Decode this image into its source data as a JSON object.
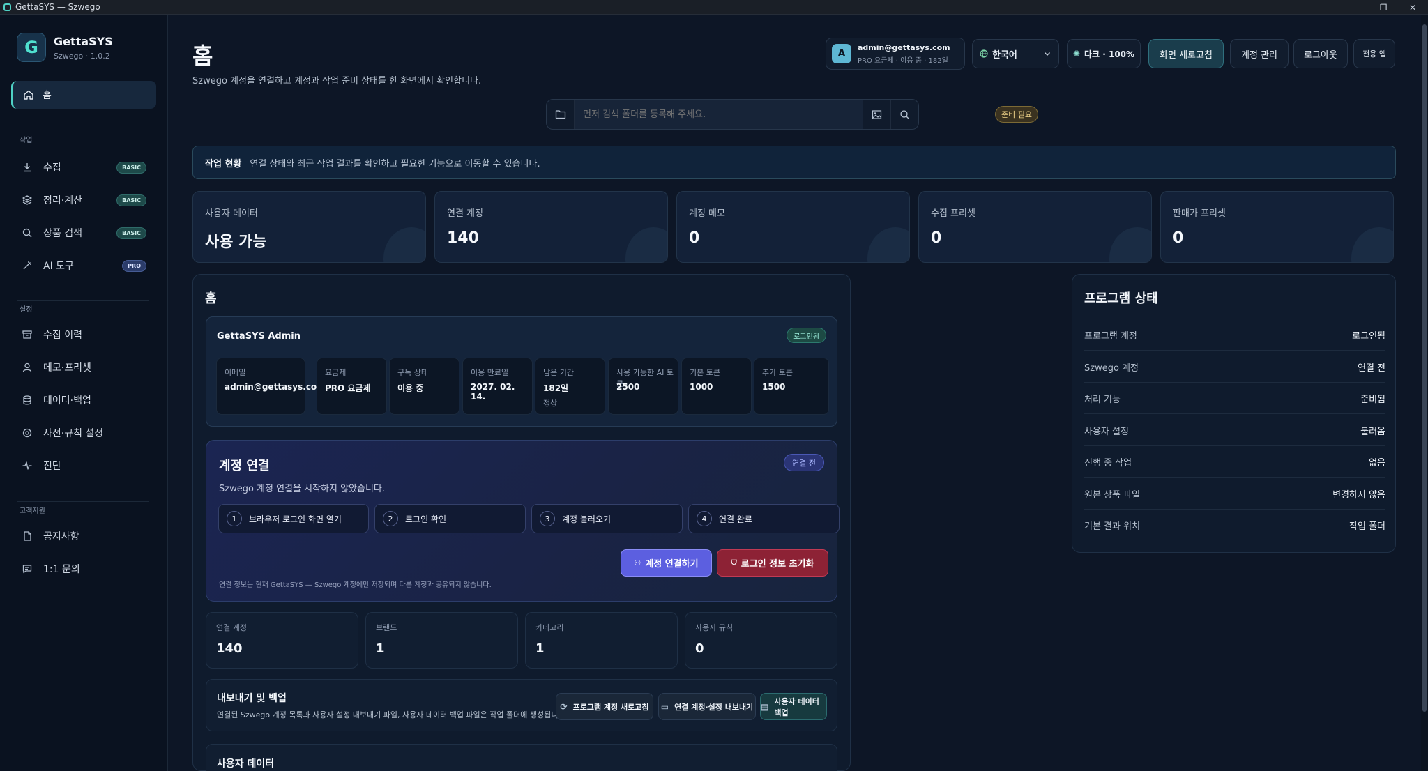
{
  "window": {
    "title": "GettaSYS — Szwego"
  },
  "brand": {
    "logo_letter": "G",
    "name": "GettaSYS",
    "version": "Szwego · 1.0.2"
  },
  "sidebar": {
    "home": "홈",
    "sections": {
      "work": "작업",
      "settings": "설정",
      "support": "고객지원"
    },
    "work_items": [
      {
        "label": "수집",
        "badge": "BASIC",
        "icon": "download-icon"
      },
      {
        "label": "정리·계산",
        "badge": "BASIC",
        "icon": "layers-icon"
      },
      {
        "label": "상품 검색",
        "badge": "BASIC",
        "icon": "search-icon"
      },
      {
        "label": "AI 도구",
        "badge": "PRO",
        "icon": "sparkle-icon"
      }
    ],
    "settings_items": [
      {
        "label": "수집 이력",
        "icon": "archive-icon"
      },
      {
        "label": "메모·프리셋",
        "icon": "user-icon"
      },
      {
        "label": "데이터·백업",
        "icon": "database-icon"
      },
      {
        "label": "사전·규칙 설정",
        "icon": "target-icon"
      },
      {
        "label": "진단",
        "icon": "pulse-icon"
      }
    ],
    "support_items": [
      {
        "label": "공지사항",
        "icon": "document-icon"
      },
      {
        "label": "1:1 문의",
        "icon": "chat-icon"
      }
    ]
  },
  "header": {
    "title": "홈",
    "subtitle": "Szwego 계정을 연결하고 계정과 작업 준비 상태를 한 화면에서 확인합니다.",
    "account": {
      "avatar": "A",
      "email": "admin@gettasys.com",
      "plan_info": "PRO 요금제 · 이용 중 · 182일"
    },
    "language": "한국어",
    "theme": "다크 · 100%",
    "refresh": "화면 새로고침",
    "account_manage": "계정 관리",
    "logout": "로그아웃",
    "dedicated_app": "전용 앱"
  },
  "search": {
    "placeholder": "먼저 검색 폴더를 등록해 주세요.",
    "status": "준비 필요"
  },
  "status_banner": {
    "title": "작업 현황",
    "text": "연결 상태와 최근 작업 결과를 확인하고 필요한 기능으로 이동할 수 있습니다."
  },
  "stats": [
    {
      "label": "사용자 데이터",
      "value": "사용 가능"
    },
    {
      "label": "연결 계정",
      "value": "140"
    },
    {
      "label": "계정 메모",
      "value": "0"
    },
    {
      "label": "수집 프리셋",
      "value": "0"
    },
    {
      "label": "판매가 프리셋",
      "value": "0"
    }
  ],
  "home_panel": {
    "title": "홈",
    "user": {
      "name": "GettaSYS Admin",
      "status": "로그인됨",
      "fields": [
        {
          "label": "이메일",
          "value": "admin@gettasys.com",
          "sub": ""
        },
        {
          "label": "요금제",
          "value": "PRO 요금제",
          "sub": ""
        },
        {
          "label": "구독 상태",
          "value": "이용 중",
          "sub": ""
        },
        {
          "label": "이용 만료일",
          "value": "2027. 02. 14.",
          "sub": ""
        },
        {
          "label": "남은 기간",
          "value": "182일",
          "sub": "정상"
        },
        {
          "label": "사용 가능한 AI 토큰",
          "value": "2500",
          "sub": ""
        },
        {
          "label": "기본 토큰",
          "value": "1000",
          "sub": ""
        },
        {
          "label": "추가 토큰",
          "value": "1500",
          "sub": ""
        }
      ]
    },
    "connection": {
      "title": "계정 연결",
      "badge": "연결 전",
      "subtitle": "Szwego 계정 연결을 시작하지 않았습니다.",
      "steps": [
        {
          "num": "1",
          "label": "브라우저 로그인 화면 열기"
        },
        {
          "num": "2",
          "label": "로그인 확인"
        },
        {
          "num": "3",
          "label": "계정 불러오기"
        },
        {
          "num": "4",
          "label": "연결 완료"
        }
      ],
      "connect_button": "계정 연결하기",
      "reset_button": "로그인 정보 초기화",
      "note": "연결 정보는 현재 GettaSYS — Szwego 계정에만 저장되며 다른 계정과 공유되지 않습니다."
    },
    "mini_stats": [
      {
        "label": "연결 계정",
        "value": "140"
      },
      {
        "label": "브랜드",
        "value": "1"
      },
      {
        "label": "카테고리",
        "value": "1"
      },
      {
        "label": "사용자 규칙",
        "value": "0"
      }
    ],
    "export": {
      "title": "내보내기 및 백업",
      "subtitle": "연결된 Szwego 계정 목록과 사용자 설정 내보내기 파일, 사용자 데이터 백업 파일은 작업 폴더에 생성됩니다.",
      "btn_refresh": "프로그램 계정 새로고침",
      "btn_export": "연결 계정·설정 내보내기",
      "btn_backup": "사용자 데이터 백업"
    },
    "user_data_title": "사용자 데이터"
  },
  "program_status": {
    "title": "프로그램 상태",
    "rows": [
      {
        "key": "프로그램 계정",
        "value": "로그인됨"
      },
      {
        "key": "Szwego 계정",
        "value": "연결 전"
      },
      {
        "key": "처리 기능",
        "value": "준비됨"
      },
      {
        "key": "사용자 설정",
        "value": "불러옴"
      },
      {
        "key": "진행 중 작업",
        "value": "없음"
      },
      {
        "key": "원본 상품 파일",
        "value": "변경하지 않음"
      },
      {
        "key": "기본 결과 위치",
        "value": "작업 폴더"
      }
    ]
  },
  "colors": {
    "accent": "#4fd1c5",
    "primary": "#5c5fe0",
    "danger": "#8d2235",
    "background": "#0d1626"
  }
}
